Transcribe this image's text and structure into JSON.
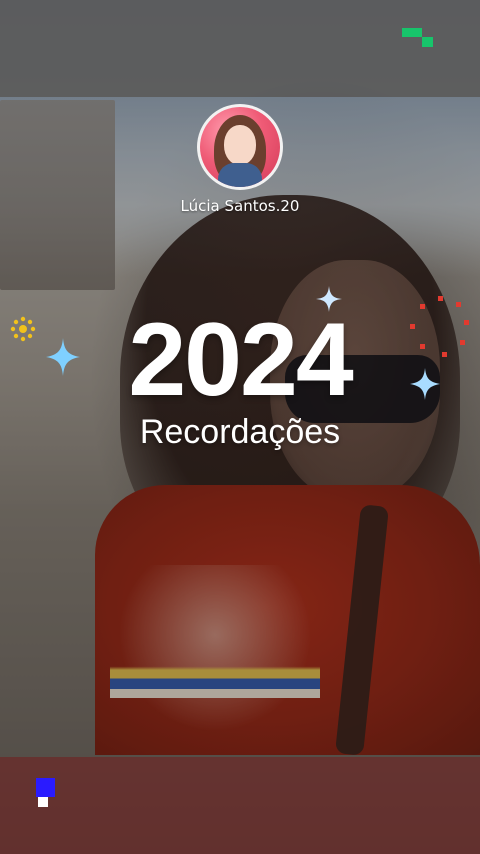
{
  "profile": {
    "username": "Lúcia Santos.20"
  },
  "main": {
    "year": "2024",
    "title": "Recordações"
  },
  "decorations": [
    "sparkle-icon",
    "sun-icon",
    "red-dots",
    "pixel-green",
    "pixel-blue"
  ],
  "colors": {
    "text": "#ffffff",
    "sparkle_blue": "#7fd0ff",
    "sun_yellow": "#f2c21b",
    "dots_red": "#e23a2f",
    "pixel_green": "#17c46b",
    "pixel_blue": "#2a1bff"
  }
}
